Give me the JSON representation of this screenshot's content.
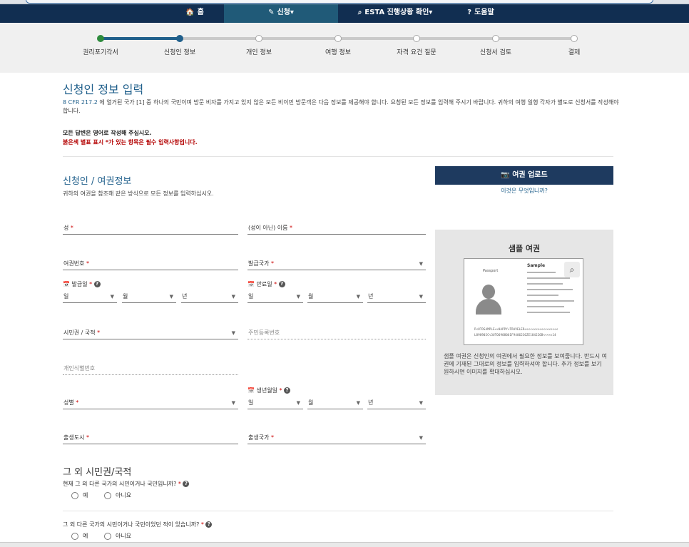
{
  "nav": {
    "home": "홈",
    "apply": "신청",
    "esta_status": "ESTA 진행상황 확인",
    "help": "도움말"
  },
  "progress": {
    "steps": [
      "권리포기각서",
      "신청인 정보",
      "개인 정보",
      "여행 정보",
      "자격 요건 질문",
      "신청서 검토",
      "결제"
    ],
    "current_index": 1
  },
  "page": {
    "title": "신청인 정보 입력",
    "intro_ref": "8 CFR 217.2",
    "intro_text": "에 열거된 국가 [1] 중 하나의 국민이며 방문 비자를 가지고 있지 않은 모든 비이민 방문객은 다음 정보를 제공해야 합니다. 요청된 모든 정보를 입력해 주시기 바랍니다. 귀하의 여행 일행 각자가 별도로 신청서를 작성해야 합니다.",
    "note_english": "모든 답변은 영어로 작성해 주십시오.",
    "note_required": "붉은색 별표 표시 *가 있는 항목은 필수 입력사항입니다."
  },
  "applicant": {
    "section_title": "신청인 / 여권정보",
    "section_sub": "귀하의 여권을 참조해 같은 방식으로 모든 정보를 입력하십시오.",
    "upload_button": "여권 업로드",
    "what_is_this": "이것은 무엇입니까?",
    "fields": {
      "surname": "성",
      "given_name": "(성이 아닌) 이름",
      "passport_number": "여권번호",
      "issuing_country": "발급국가",
      "issue_date": "발급일",
      "expiry_date": "만료일",
      "day": "일",
      "month": "월",
      "year": "년",
      "citizenship": "시민권 / 국적",
      "national_id": "주민등록번호",
      "personal_id": "개인식별번호",
      "birth_date": "생년월일",
      "gender": "성별",
      "birth_city": "출생도시",
      "birth_country": "출생국가",
      "required_mark": "*"
    }
  },
  "sample": {
    "title": "샘플 여권",
    "passport_header": "Sample",
    "passport_label": "Passport",
    "mrz1": "P<UTOSAMPLE<<HAPPY<TRAVELER<<<<<<<<<<<<<<<<<<",
    "mrz2": "L898902C<3UTO6908061F9406236ZE184226B<<<<<14",
    "description": "샘플 여권은 신청인의 여권에서 필요한 정보를 보여줍니다. 반드시 여권에 기재된 그대로의 정보를 입력하셔야 합니다. 추가 정보를 보기 원하시면 이미지를 확대하십시오."
  },
  "other_citizenship": {
    "title": "그 외 시민권/국적",
    "q1": "현재 그 외 다른 국가의 시민이거나 국민입니까?",
    "q2": "그 외 다른 국가의 시민이거나 국민이었던 적이 있습니까?",
    "yes": "예",
    "no": "아니요"
  }
}
